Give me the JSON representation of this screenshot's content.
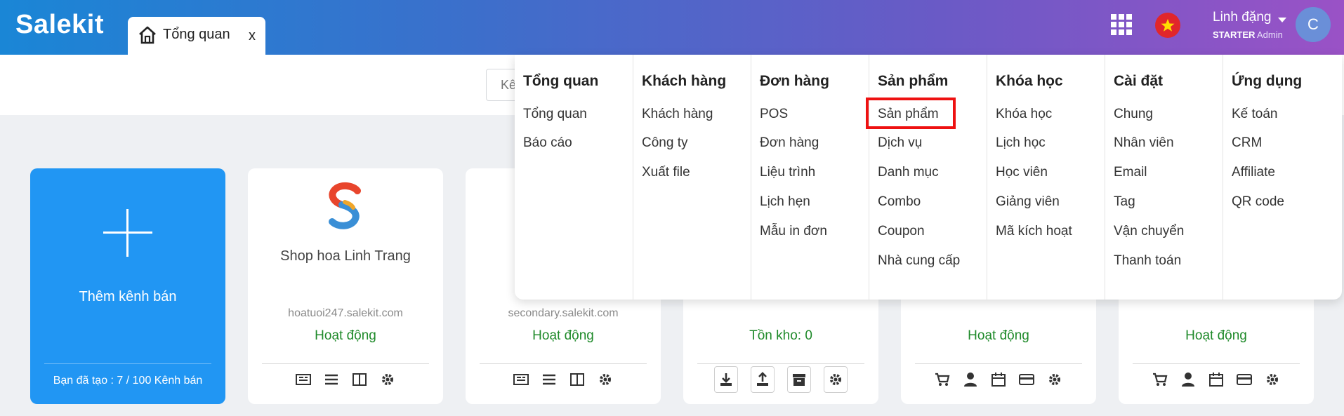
{
  "app": {
    "logo": "Salekit"
  },
  "tabs": [
    {
      "label": "Tổng quan",
      "close": "x"
    }
  ],
  "user": {
    "name": "Linh đặng",
    "plan": "STARTER",
    "role": "Admin",
    "avatar_letter": "C"
  },
  "search": {
    "placeholder": "Kê"
  },
  "add_card": {
    "label": "Thêm kênh bán",
    "count": "Bạn đã tạo : 7 / 100 Kênh bán"
  },
  "cards": [
    {
      "title": "Shop hoa Linh Trang",
      "url": "hoatuoi247.salekit.com",
      "status": "Hoạt động"
    },
    {
      "title": "",
      "url": "secondary.salekit.com",
      "status": "Hoạt động"
    },
    {
      "title": "",
      "url": "",
      "status": "Tồn kho: 0"
    },
    {
      "title": "",
      "url": "",
      "status": "Hoạt động"
    },
    {
      "title": "",
      "url": "",
      "status": "Hoạt động"
    }
  ],
  "menu": {
    "columns": [
      {
        "title": "Tổng quan",
        "items": [
          "Tổng quan",
          "Báo cáo"
        ]
      },
      {
        "title": "Khách hàng",
        "items": [
          "Khách hàng",
          "Công ty",
          "Xuất file"
        ]
      },
      {
        "title": "Đơn hàng",
        "items": [
          "POS",
          "Đơn hàng",
          "Liệu trình",
          "Lịch hẹn",
          "Mẫu in đơn"
        ]
      },
      {
        "title": "Sản phẩm",
        "items": [
          "Sản phẩm",
          "Dịch vụ",
          "Danh mục",
          "Combo",
          "Coupon",
          "Nhà cung cấp"
        ]
      },
      {
        "title": "Khóa học",
        "items": [
          "Khóa học",
          "Lịch học",
          "Học viên",
          "Giảng viên",
          "Mã kích hoạt"
        ]
      },
      {
        "title": "Cài đặt",
        "items": [
          "Chung",
          "Nhân viên",
          "Email",
          "Tag",
          "Vận chuyển",
          "Thanh toán"
        ]
      },
      {
        "title": "Ứng dụng",
        "items": [
          "Kế toán",
          "CRM",
          "Affiliate",
          "QR code"
        ]
      }
    ]
  },
  "colors": {
    "accent_blue": "#2196f3",
    "status_green": "#1f8a2a",
    "highlight_red": "#e11111"
  },
  "icons": [
    "grid-icon",
    "vn-flag-icon",
    "home-icon"
  ]
}
